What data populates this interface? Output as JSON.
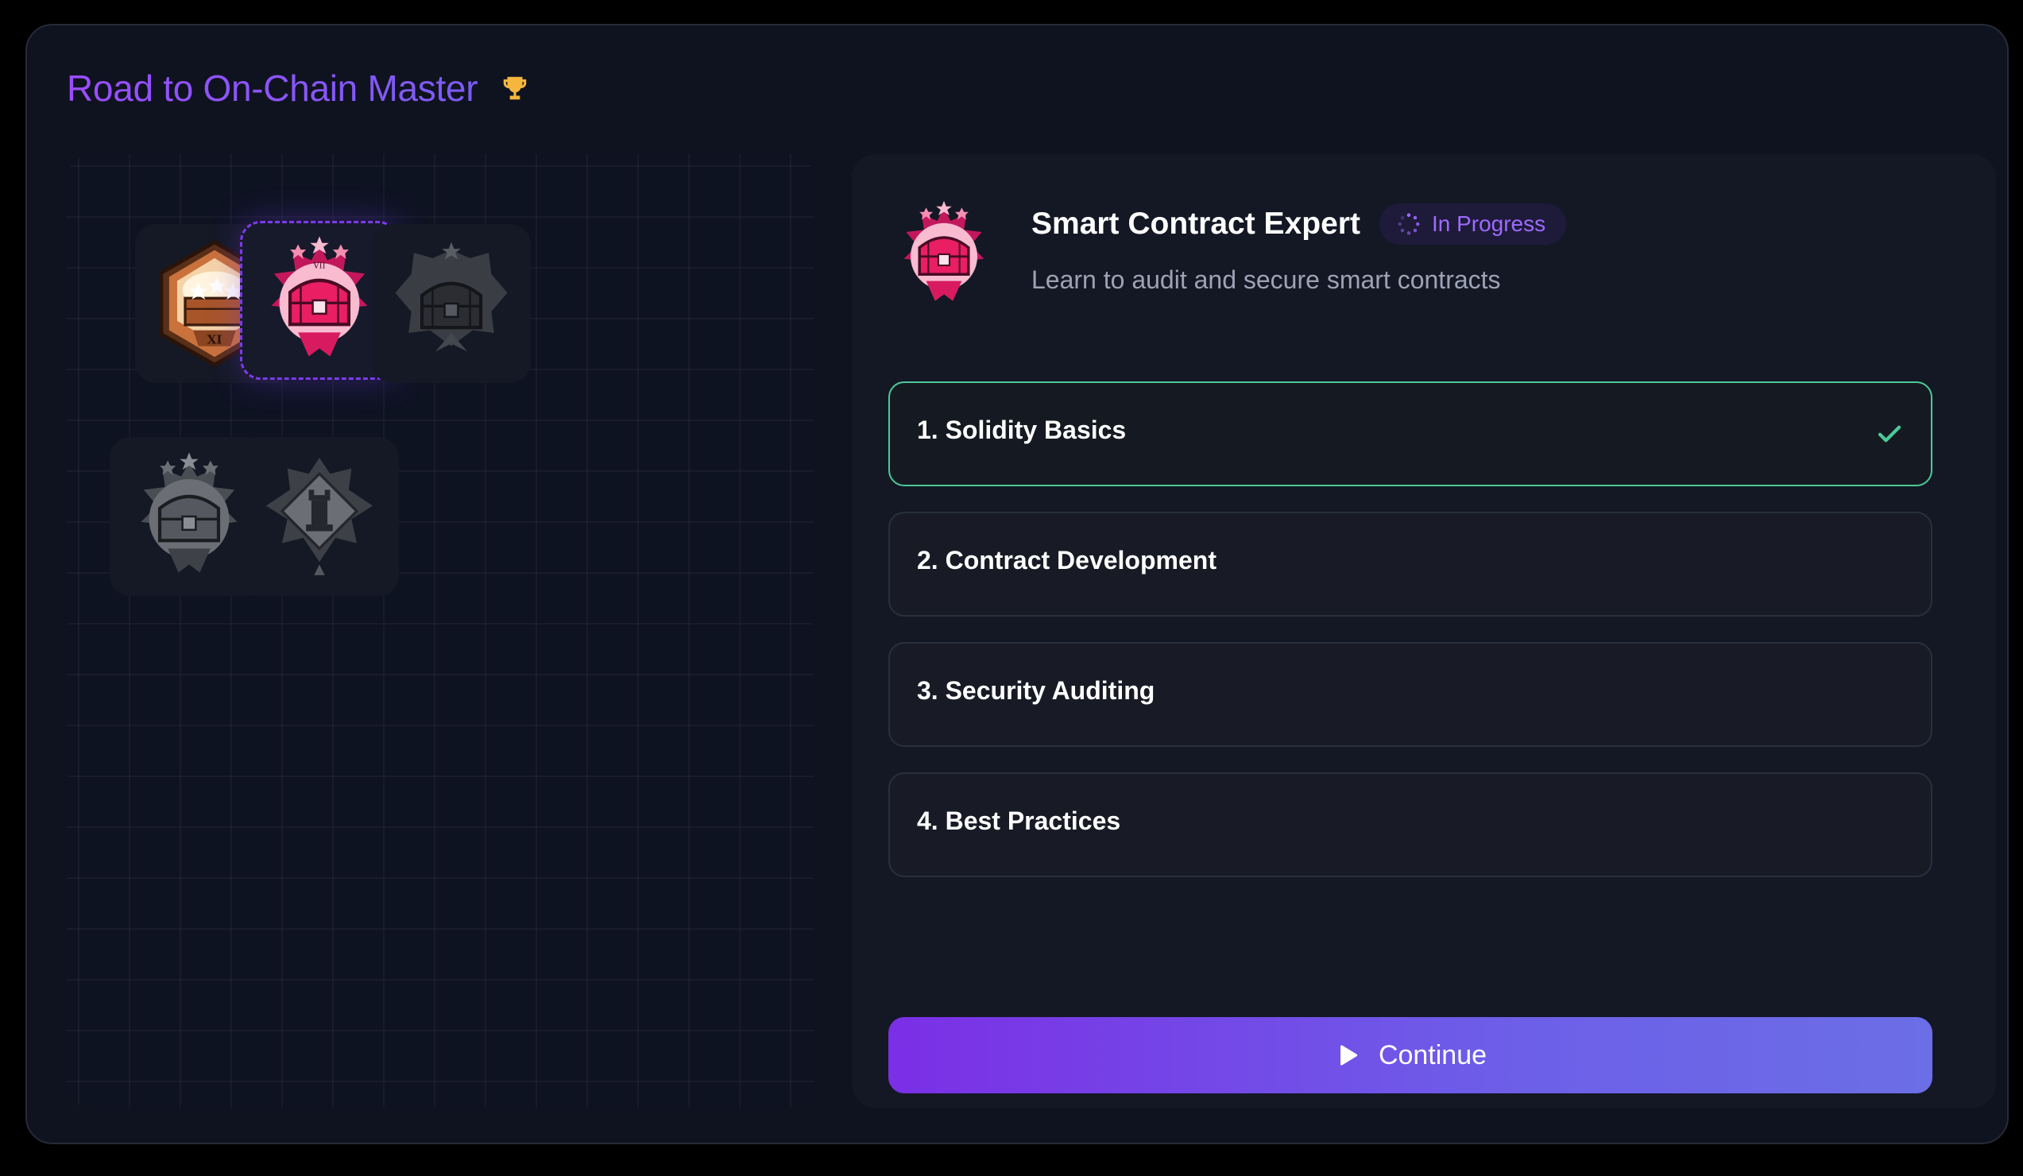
{
  "header": {
    "title": "Road to On-Chain Master",
    "trophy_icon": "trophy-icon"
  },
  "badges": [
    {
      "name": "bronze-chest-badge",
      "state": "unlocked",
      "numeral": "XI"
    },
    {
      "name": "pink-chest-badge",
      "state": "selected",
      "numeral": "VII"
    },
    {
      "name": "gray-chest-badge",
      "state": "locked"
    },
    {
      "name": "gray-chest-badge-2",
      "state": "locked"
    },
    {
      "name": "gray-rook-badge",
      "state": "locked"
    }
  ],
  "detail": {
    "name": "Smart Contract Expert",
    "status": "In Progress",
    "description": "Learn to audit and secure smart contracts",
    "steps": [
      {
        "label": "1. Solidity Basics",
        "completed": true
      },
      {
        "label": "2. Contract Development",
        "completed": false
      },
      {
        "label": "3. Security Auditing",
        "completed": false
      },
      {
        "label": "4. Best Practices",
        "completed": false
      }
    ],
    "continue_label": "Continue"
  },
  "colors": {
    "accent": "#7c3aed",
    "success": "#4cc99a",
    "status_text": "#9d6bff"
  }
}
